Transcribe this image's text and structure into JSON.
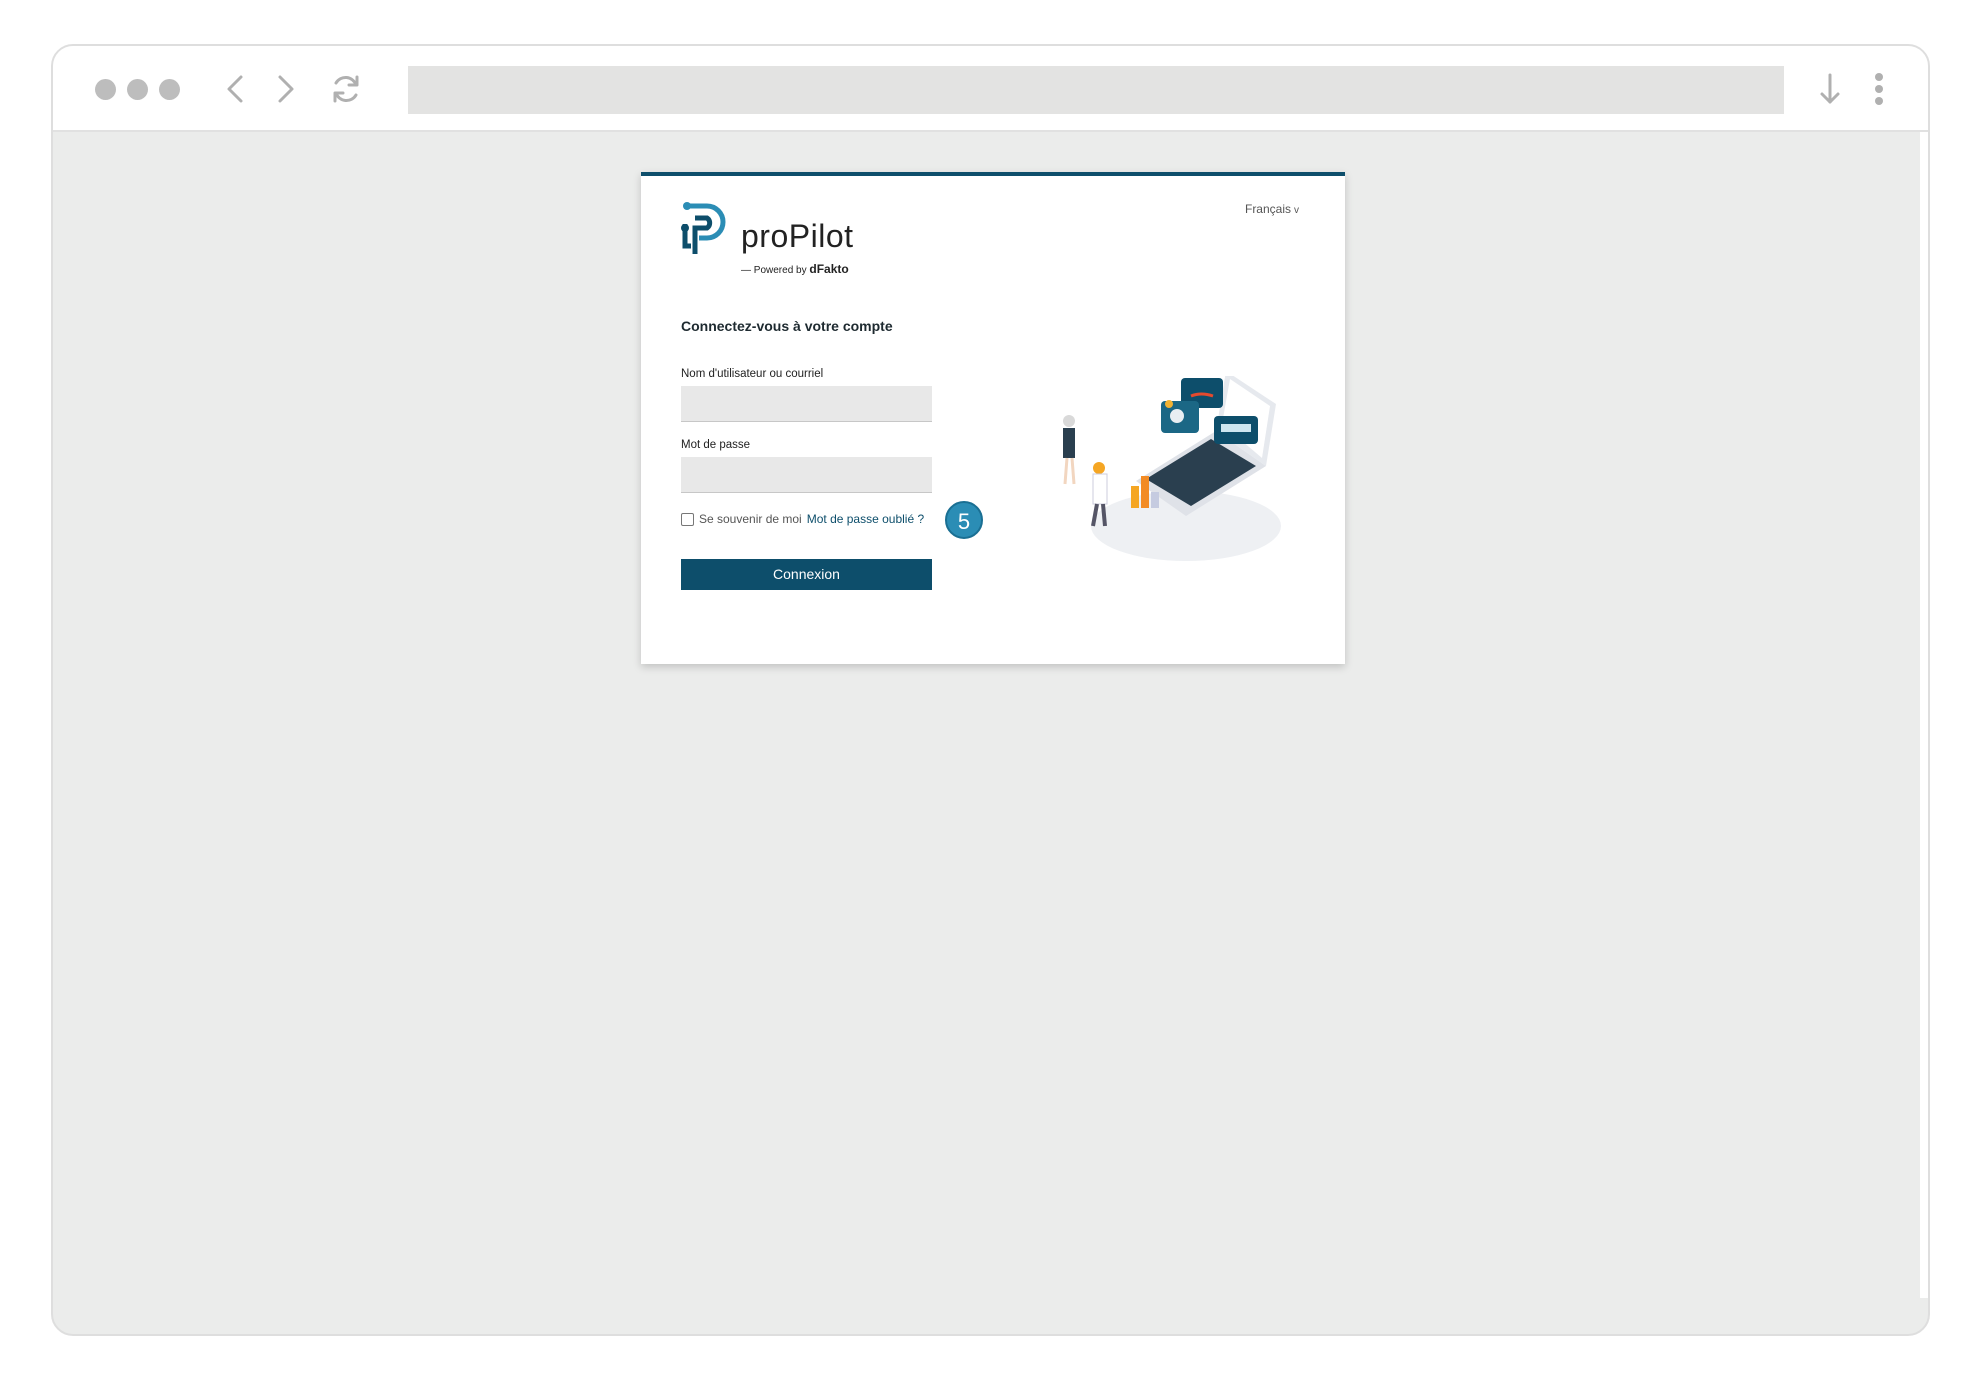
{
  "browser": {
    "url": "",
    "icons": [
      "window-dot-icon",
      "back-icon",
      "forward-icon",
      "reload-icon",
      "download-icon",
      "menu-kebab-icon"
    ]
  },
  "login": {
    "language": "Français",
    "brand_name": "proPilot",
    "powered_by_prefix": "Powered by",
    "powered_by_brand": "dFakto",
    "heading": "Connectez-vous à votre compte",
    "username_label": "Nom d'utilisateur ou courriel",
    "username_value": "",
    "password_label": "Mot de passe",
    "password_value": "",
    "remember_label": "Se souvenir de moi",
    "remember_checked": false,
    "forgot_label": "Mot de passe oublié ?",
    "submit_label": "Connexion",
    "step_number": "5"
  },
  "colors": {
    "brand": "#0d4e6b",
    "accent": "#2b8db5",
    "background": "#ebeceb"
  }
}
